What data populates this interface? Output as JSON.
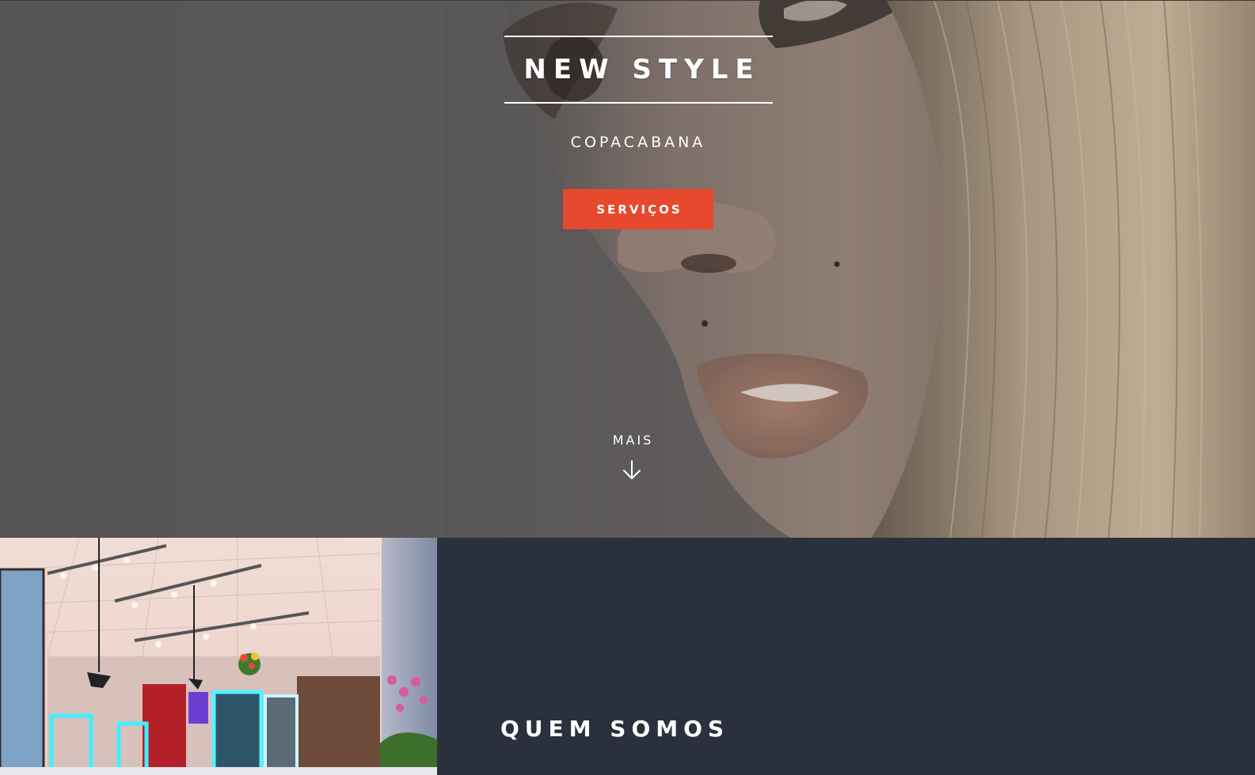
{
  "hero": {
    "title": "NEW STYLE",
    "subtitle": "COPACABANA",
    "cta_label": "SERVIÇOS",
    "more_label": "MAIS",
    "more_icon": "arrow-down-icon",
    "background_image": "close-up-face-photo"
  },
  "about": {
    "heading": "QUEM SOMOS",
    "image": "salon-interior-photo",
    "background_color": "#2a313c"
  },
  "colors": {
    "accent": "#e6492d",
    "text": "#ffffff",
    "dark_section": "#2a313c"
  }
}
